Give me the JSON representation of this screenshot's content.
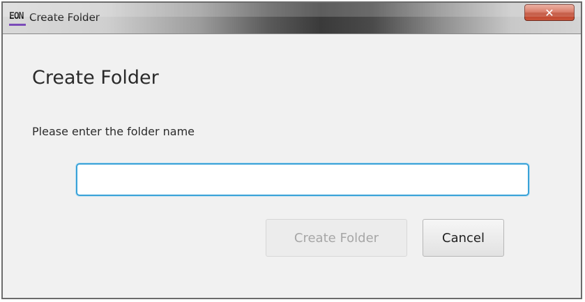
{
  "window": {
    "app_logo": "EON",
    "title": "Create Folder",
    "close_label": "✕"
  },
  "dialog": {
    "heading": "Create Folder",
    "prompt": "Please enter the folder name",
    "folder_name_value": "",
    "folder_name_placeholder": "",
    "create_button_label": "Create Folder",
    "create_button_enabled": false,
    "cancel_button_label": "Cancel"
  },
  "colors": {
    "input_focus_border": "#39a2d8",
    "close_button": "#c9553b",
    "logo_accent": "#7b4bb8"
  }
}
